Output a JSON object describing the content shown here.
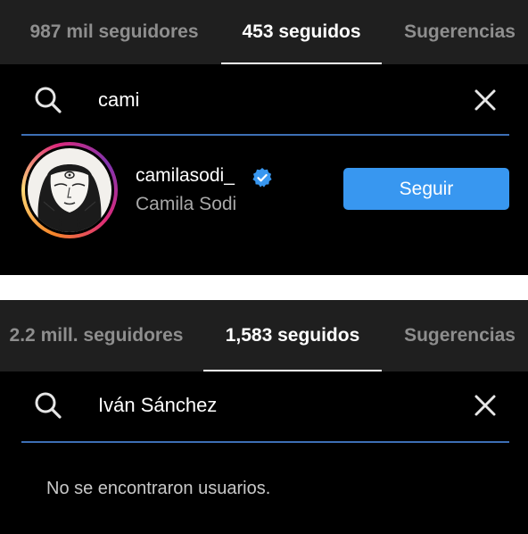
{
  "screen_top": {
    "tabs": [
      {
        "label": "987 mil seguidores",
        "active": false
      },
      {
        "label": "453 seguidos",
        "active": true
      },
      {
        "label": "Sugerencias",
        "active": false
      }
    ],
    "search": {
      "value": "cami"
    },
    "result": {
      "username": "camilasodi_",
      "full_name": "Camila Sodi",
      "verified": true,
      "button_label": "Seguir"
    }
  },
  "screen_bottom": {
    "tabs": [
      {
        "label": "2.2 mill. seguidores",
        "active": false
      },
      {
        "label": "1,583 seguidos",
        "active": true
      },
      {
        "label": "Sugerencias",
        "active": false
      }
    ],
    "search": {
      "value": "Iván Sánchez"
    },
    "empty_message": "No se encontraron usuarios."
  },
  "colors": {
    "background": "#000000",
    "tabbar": "#1f1f1f",
    "accent_blue": "#3897f0",
    "search_line": "#3d6fb5",
    "verified_badge": "#3897f0",
    "inactive_text": "#8e8e8e"
  },
  "icons": [
    "search-icon",
    "close-icon",
    "verified-badge-icon"
  ]
}
